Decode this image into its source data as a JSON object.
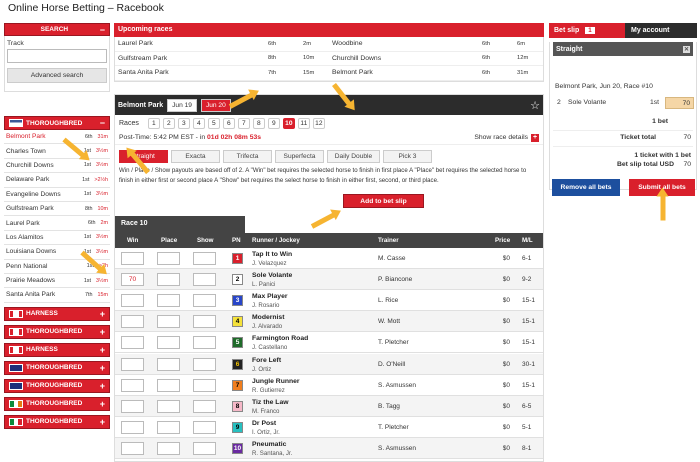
{
  "app": {
    "title": "Online Horse Betting – Racebook"
  },
  "sidebar": {
    "search_label": "SEARCH",
    "track_label": "Track",
    "track_value": "",
    "advanced": "Advanced search",
    "tb_label": "THOROUGHBRED",
    "tracks": [
      {
        "name": "Belmont Park",
        "p": "6th",
        "t": "31m",
        "active": true
      },
      {
        "name": "Charles Town",
        "p": "1st",
        "t": "3½m"
      },
      {
        "name": "Churchill Downs",
        "p": "1st",
        "t": "3½m"
      },
      {
        "name": "Delaware Park",
        "p": "1st",
        "t": ">2½h"
      },
      {
        "name": "Evangeline Downs",
        "p": "1st",
        "t": "3½m"
      },
      {
        "name": "Gulfstream Park",
        "p": "8th",
        "t": "10m"
      },
      {
        "name": "Laurel Park",
        "p": "6th",
        "t": "2m"
      },
      {
        "name": "Los Alamitos",
        "p": "1st",
        "t": "3½m"
      },
      {
        "name": "Louisiana Downs",
        "p": "1st",
        "t": "3½m"
      },
      {
        "name": "Penn National",
        "p": "1st",
        "t": ">2h"
      },
      {
        "name": "Prairie Meadows",
        "p": "1st",
        "t": "3½m"
      },
      {
        "name": "Santa Anita Park",
        "p": "7th",
        "t": "15m"
      }
    ],
    "cats": [
      "HARNESS",
      "THOROUGHBRED",
      "HARNESS",
      "THOROUGHBRED",
      "THOROUGHBRED",
      "THOROUGHBRED",
      "THOROUGHBRED"
    ]
  },
  "upcoming": {
    "title": "Upcoming races",
    "left": [
      [
        "Laurel Park",
        "6th",
        "2m"
      ],
      [
        "Gulfstream Park",
        "8th",
        "10m"
      ],
      [
        "Santa Anita Park",
        "7th",
        "15m"
      ]
    ],
    "right": [
      [
        "Woodbine",
        "6th",
        "6m"
      ],
      [
        "Churchill Downs",
        "6th",
        "12m"
      ],
      [
        "Belmont Park",
        "6th",
        "31m"
      ]
    ]
  },
  "race": {
    "track": "Belmont Park",
    "dates": [
      "Jun 19",
      "Jun 20"
    ],
    "races_label": "Races",
    "numbers": [
      "1",
      "2",
      "3",
      "4",
      "5",
      "6",
      "7",
      "8",
      "9",
      "10",
      "11",
      "12"
    ],
    "selected": "10",
    "post_label": "Post-Time: 5:42 PM EST - in",
    "countdown": "01d 02h 08m 53s",
    "details": "Show race details",
    "bet_types": [
      "Straight",
      "Exacta",
      "Trifecta",
      "Superfecta",
      "Daily Double",
      "Pick 3"
    ],
    "desc": "Win / Place / Show payouts are based off of 2. A \"Win\" bet requires the selected horse to finish in first place A \"Place\" bet requires the selected horse to finish in either first or second place A \"Show\" bet requires the select horse to finish in either first, second, or third place.",
    "add_btn": "Add to bet slip",
    "race_title": "Race 10",
    "cols": [
      "Win",
      "Place",
      "Show",
      "PN",
      "Runner / Jockey",
      "Trainer",
      "Price",
      "M/L"
    ],
    "runners": [
      {
        "pn": "1",
        "horse": "Tap It to Win",
        "jockey": "J. Velazquez",
        "trainer": "M. Casse",
        "price": "$0",
        "ml": "6-1",
        "win": "",
        "bg": "#d9202c",
        "fg": "#fff"
      },
      {
        "pn": "2",
        "horse": "Sole Volante",
        "jockey": "L. Panici",
        "trainer": "P. Biancone",
        "price": "$0",
        "ml": "9-2",
        "win": "70",
        "bg": "#ffffff",
        "fg": "#000"
      },
      {
        "pn": "3",
        "horse": "Max Player",
        "jockey": "J. Rosario",
        "trainer": "L. Rice",
        "price": "$0",
        "ml": "15-1",
        "win": "",
        "bg": "#2845c8",
        "fg": "#fff"
      },
      {
        "pn": "4",
        "horse": "Modernist",
        "jockey": "J. Alvarado",
        "trainer": "W. Mott",
        "price": "$0",
        "ml": "15-1",
        "win": "",
        "bg": "#f5e23a",
        "fg": "#000"
      },
      {
        "pn": "5",
        "horse": "Farmington Road",
        "jockey": "J. Castellano",
        "trainer": "T. Pletcher",
        "price": "$0",
        "ml": "15-1",
        "win": "",
        "bg": "#1f6b2a",
        "fg": "#fff"
      },
      {
        "pn": "6",
        "horse": "Fore Left",
        "jockey": "J. Ortiz",
        "trainer": "D. O'Neill",
        "price": "$0",
        "ml": "30-1",
        "win": "",
        "bg": "#222222",
        "fg": "#f5c400"
      },
      {
        "pn": "7",
        "horse": "Jungle Runner",
        "jockey": "R. Gutierrez",
        "trainer": "S. Asmussen",
        "price": "$0",
        "ml": "15-1",
        "win": "",
        "bg": "#f07e1e",
        "fg": "#000"
      },
      {
        "pn": "8",
        "horse": "Tiz the Law",
        "jockey": "M. Franco",
        "trainer": "B. Tagg",
        "price": "$0",
        "ml": "6-5",
        "win": "",
        "bg": "#f6b8c8",
        "fg": "#000"
      },
      {
        "pn": "9",
        "horse": "Dr Post",
        "jockey": "I. Ortiz, Jr.",
        "trainer": "T. Pletcher",
        "price": "$0",
        "ml": "5-1",
        "win": "",
        "bg": "#27c0c0",
        "fg": "#000"
      },
      {
        "pn": "10",
        "horse": "Pneumatic",
        "jockey": "R. Santana, Jr.",
        "trainer": "S. Asmussen",
        "price": "$0",
        "ml": "8-1",
        "win": "",
        "bg": "#6a2aa0",
        "fg": "#fff"
      }
    ]
  },
  "betslip": {
    "tab": "Bet slip",
    "count": "1",
    "account": "My account",
    "type": "Straight",
    "race": "Belmont Park, Jun 20, Race #10",
    "sel_pn": "2",
    "sel_horse": "Sole Volante",
    "sel_pos": "1st",
    "sel_amount": "70",
    "bets": "1 bet",
    "total_label": "Ticket total",
    "total": "70",
    "sum1": "1 ticket with 1 bet",
    "sum2": "Bet slip total USD",
    "sum2_val": "70",
    "remove": "Remove all bets",
    "submit": "Submit all bets"
  },
  "colors": {
    "accent": "#d9202c",
    "dark": "#2c2c2c",
    "arrow": "#f6b431"
  }
}
